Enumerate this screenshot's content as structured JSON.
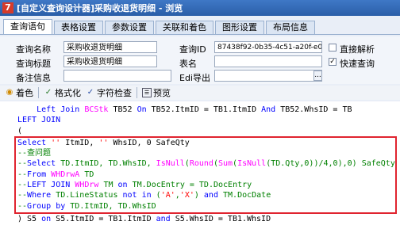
{
  "window": {
    "title": "[自定义查询设计器]采购收退货明细 - 浏览",
    "icon_glyph": "7"
  },
  "tabs": [
    "查询语句",
    "表格设置",
    "参数设置",
    "关联和着色",
    "图形设置",
    "布局信息"
  ],
  "form": {
    "query_name_label": "查询名称",
    "query_name_value": "采购收退货明细",
    "query_id_label": "查询ID",
    "query_id_value": "87438f92-0b35-4c51-a20f-e044",
    "direct_parse_label": "直接解析",
    "direct_parse_checked": false,
    "query_title_label": "查询标题",
    "query_title_value": "采购收退货明细",
    "table_name_label": "表名",
    "table_name_value": "",
    "fast_query_label": "快速查询",
    "fast_query_checked": true,
    "note_label": "备注信息",
    "note_value": "",
    "edi_export_label": "Edi导出",
    "edi_export_value": "",
    "ellipsis": "..."
  },
  "toolbar": {
    "color_label": "着色",
    "format_label": "格式化",
    "check_label": "字符检查",
    "preview_label": "预览"
  },
  "editor": {
    "lines": [
      "    Left Join BCStk TB52 On TB52.ItmID = TB1.ItmID And TB52.WhsID = TB",
      "LEFT JOIN",
      "(",
      "Select '' ItmID, '' WhsID, 0 SafeQty",
      "--查问题",
      "--Select TD.ItmID, TD.WhsID, IsNull(Round(Sum(IsNull(TD.Qty,0))/4,0),0) SafeQty",
      "--From WHDrwA TD",
      "--LEFT JOIN WHDrw TM on TM.DocEntry = TD.DocEntry",
      "--Where TD.LineStatus not in ('A','X') and TM.DocDate",
      "--Group by TD.ItmID, TD.WhsID",
      ") S5 on S5.ItmID = TB1.ItmID and S5.WhsID = TB1.WhsID"
    ]
  }
}
